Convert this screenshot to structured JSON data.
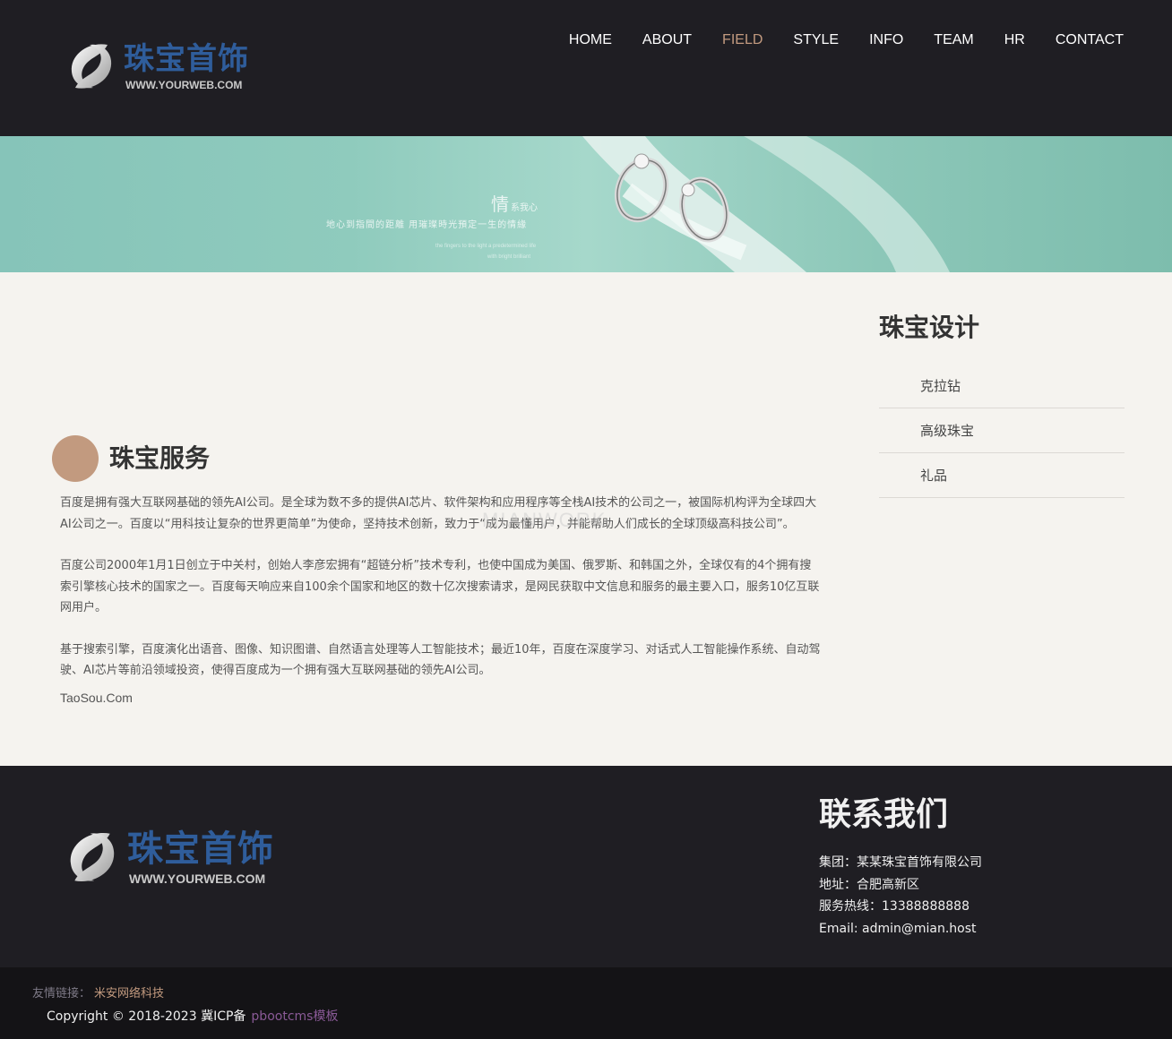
{
  "header": {
    "logo_title": "珠宝首饰",
    "logo_sub": "WWW.YOURWEB.COM",
    "nav": [
      {
        "label": "HOME"
      },
      {
        "label": "ABOUT"
      },
      {
        "label": "FIELD",
        "active": true
      },
      {
        "label": "STYLE"
      },
      {
        "label": "INFO"
      },
      {
        "label": "TEAM"
      },
      {
        "label": "HR"
      },
      {
        "label": "CONTACT"
      }
    ]
  },
  "banner": {
    "big_char": "情",
    "big_small": "系我心",
    "line": "地心到指間的距離 用璀璨時光預定一生的情緣",
    "eng1": "the fingers to the light a predetermined life",
    "eng2": "with bright brilliant"
  },
  "main": {
    "section_title": "珠宝服务",
    "paragraphs": [
      " 百度是拥有强大互联网基础的领先AI公司。是全球为数不多的提供AI芯片、软件架构和应用程序等全栈AI技术的公司之一，被国际机构评为全球四大AI公司之一。百度以“用科技让复杂的世界更简单”为使命，坚持技术创新，致力于“成为最懂用户，并能帮助人们成长的全球顶级高科技公司”。",
      "百度公司2000年1月1日创立于中关村，创始人李彦宏拥有“超链分析”技术专利，也使中国成为美国、俄罗斯、和韩国之外，全球仅有的4个拥有搜索引擎核心技术的国家之一。百度每天响应来自100余个国家和地区的数十亿次搜索请求，是网民获取中文信息和服务的最主要入口，服务10亿互联网用户。",
      "基于搜索引擎，百度演化出语音、图像、知识图谱、自然语言处理等人工智能技术；最近10年，百度在深度学习、对话式人工智能操作系统、自动驾驶、AI芯片等前沿领域投资，使得百度成为一个拥有强大互联网基础的领先AI公司。"
    ],
    "source": "TaoSou.Com",
    "watermark": "MIANWORK"
  },
  "sidebar": {
    "title": "珠宝设计",
    "items": [
      {
        "label": "克拉钻"
      },
      {
        "label": "高级珠宝"
      },
      {
        "label": "礼品"
      }
    ]
  },
  "footer": {
    "logo_title": "珠宝首饰",
    "logo_sub": "WWW.YOURWEB.COM",
    "contact_title": "联系我们",
    "contact_lines": [
      "集团：某某珠宝首饰有限公司",
      "地址：合肥高新区",
      "服务热线：13388888888",
      "Email: admin@mian.host"
    ],
    "links_label": "友情链接：",
    "link_1": "米安网络科技",
    "copyright": "Copyright © 2018-2023 冀ICP备",
    "copyright_link": "pbootcms模板"
  },
  "colors": {
    "accent": "#c29a7f",
    "logo_blue": "#2f5d9b",
    "dark_bg": "#1f1e23",
    "page_bg": "#f5f3ef"
  }
}
